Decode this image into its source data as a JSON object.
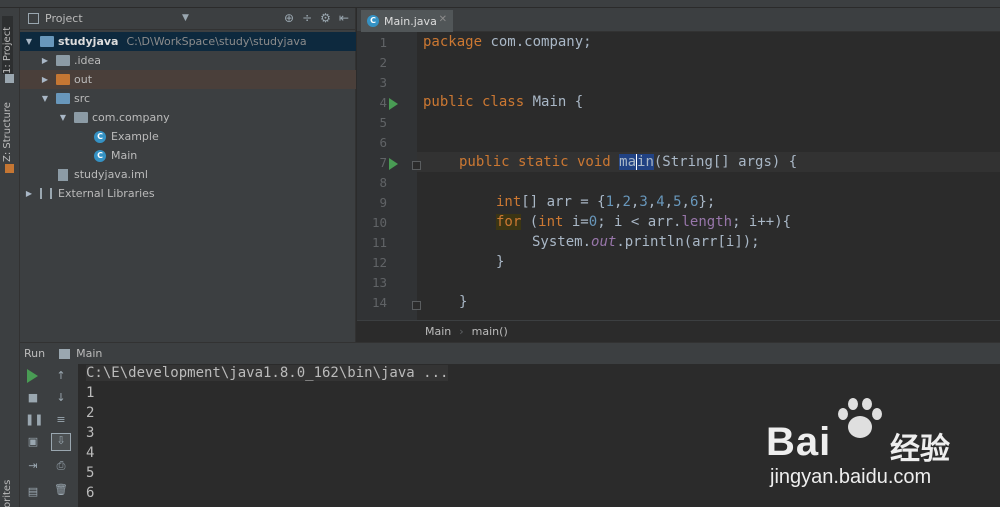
{
  "sidebar_tabs": {
    "project": "1: Project",
    "structure": "Z: Structure",
    "favorites": "orites"
  },
  "project_panel": {
    "title": "Project",
    "tree": [
      {
        "label": "studyjava",
        "path": "C:\\D\\WorkSpace\\study\\studyjava"
      },
      {
        "label": ".idea"
      },
      {
        "label": "out"
      },
      {
        "label": "src"
      },
      {
        "label": "com.company"
      },
      {
        "label": "Example"
      },
      {
        "label": "Main"
      },
      {
        "label": "studyjava.iml"
      },
      {
        "label": "External Libraries"
      }
    ]
  },
  "editor": {
    "tab_label": "Main.java",
    "line_numbers": [
      "1",
      "2",
      "3",
      "4",
      "5",
      "6",
      "7",
      "8",
      "9",
      "10",
      "11",
      "12",
      "13",
      "14"
    ],
    "code": {
      "l1_kw": "package",
      "l1_rest": " com.company;",
      "l4_kw": "public class",
      "l4_rest": " Main {",
      "l7_kw": "public static void",
      "l7_name_a": "ma",
      "l7_name_b": "in",
      "l7_rest": "(String[] args) {",
      "l9_kw": "int",
      "l9_a": "[] arr = {",
      "nums": [
        "1",
        "2",
        "3",
        "4",
        "5",
        "6"
      ],
      "l9_end": "};",
      "l10_kw": "for",
      "l10_a": " (",
      "l10_kw2": "int",
      "l10_b": " i=",
      "l10_zero": "0",
      "l10_c": "; i < arr.",
      "l10_len": "length",
      "l10_d": "; i++){",
      "l11_a": "System.",
      "l11_out": "out",
      "l11_b": ".println(arr[i]);",
      "l12": "}",
      "l14": "}"
    },
    "breadcrumb": [
      "Main",
      "main()"
    ]
  },
  "run_panel": {
    "label": "Run",
    "config": "Main",
    "console_lines": [
      "C:\\E\\development\\java1.8.0_162\\bin\\java ...",
      "1",
      "2",
      "3",
      "4",
      "5",
      "6"
    ]
  },
  "watermark": {
    "brand": "Bai",
    "brand_cn": "经验",
    "url": "jingyan.baidu.com"
  }
}
